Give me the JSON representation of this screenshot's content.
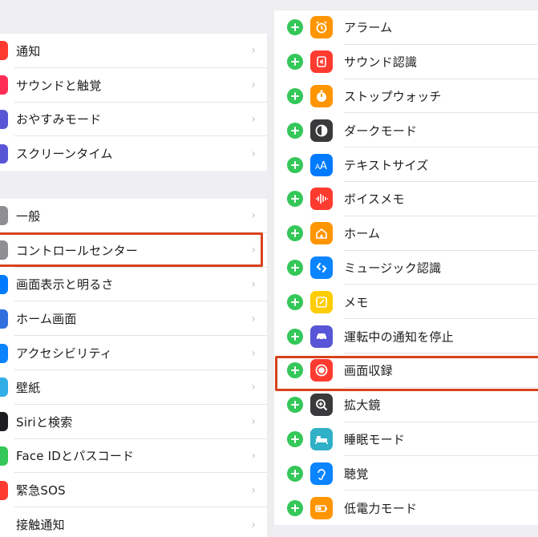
{
  "settings_list": {
    "group1": [
      {
        "label": "通知",
        "icon": "bell-icon",
        "color": "#ff3b30"
      },
      {
        "label": "サウンドと触覚",
        "icon": "speaker-icon",
        "color": "#ff2d55"
      },
      {
        "label": "おやすみモード",
        "icon": "moon-icon",
        "color": "#5856d6"
      },
      {
        "label": "スクリーンタイム",
        "icon": "hourglass-icon",
        "color": "#5856d6"
      }
    ],
    "group2": [
      {
        "label": "一般",
        "icon": "gear-icon",
        "color": "#8e8e93"
      },
      {
        "label": "コントロールセンター",
        "icon": "switches-icon",
        "color": "#8e8e93",
        "highlighted": true
      },
      {
        "label": "画面表示と明るさ",
        "icon": "aa-icon",
        "color": "#007aff"
      },
      {
        "label": "ホーム画面",
        "icon": "grid-icon",
        "color": "#2f6fde"
      },
      {
        "label": "アクセシビリティ",
        "icon": "accessibility-icon",
        "color": "#0a84ff"
      },
      {
        "label": "壁紙",
        "icon": "flower-icon",
        "color": "#32ade6"
      },
      {
        "label": "Siriと検索",
        "icon": "siri-icon",
        "color": "#1c1c1e"
      },
      {
        "label": "Face IDとパスコード",
        "icon": "faceid-icon",
        "color": "#34c759"
      },
      {
        "label": "緊急SOS",
        "icon": "sos-icon",
        "color": "#ff3b30"
      },
      {
        "label": "接触通知",
        "icon": "exposure-icon",
        "color": "#ffffff"
      }
    ]
  },
  "control_center_more": [
    {
      "label": "アラーム",
      "icon": "alarm-icon",
      "color": "#ff9500"
    },
    {
      "label": "サウンド認識",
      "icon": "sound-recognition-icon",
      "color": "#ff3b30"
    },
    {
      "label": "ストップウォッチ",
      "icon": "stopwatch-icon",
      "color": "#ff9500"
    },
    {
      "label": "ダークモード",
      "icon": "dark-mode-icon",
      "color": "#3a3a3c"
    },
    {
      "label": "テキストサイズ",
      "icon": "text-size-icon",
      "color": "#007aff"
    },
    {
      "label": "ボイスメモ",
      "icon": "voice-memo-icon",
      "color": "#ff3b30"
    },
    {
      "label": "ホーム",
      "icon": "home-icon",
      "color": "#ff9500"
    },
    {
      "label": "ミュージック認識",
      "icon": "shazam-icon",
      "color": "#0a84ff"
    },
    {
      "label": "メモ",
      "icon": "note-icon",
      "color": "#ffcc00"
    },
    {
      "label": "運転中の通知を停止",
      "icon": "car-icon",
      "color": "#5856d6"
    },
    {
      "label": "画面収録",
      "icon": "screen-record-icon",
      "color": "#ff3b30",
      "highlighted": true
    },
    {
      "label": "拡大鏡",
      "icon": "magnifier-icon",
      "color": "#3a3a3c"
    },
    {
      "label": "睡眠モード",
      "icon": "bed-icon",
      "color": "#30b0c7"
    },
    {
      "label": "聴覚",
      "icon": "ear-icon",
      "color": "#0a84ff"
    },
    {
      "label": "低電力モード",
      "icon": "battery-icon",
      "color": "#ff9500"
    }
  ],
  "accent": {
    "add_button": "#34c759",
    "highlight": "#d8421b",
    "chevron": "›"
  }
}
